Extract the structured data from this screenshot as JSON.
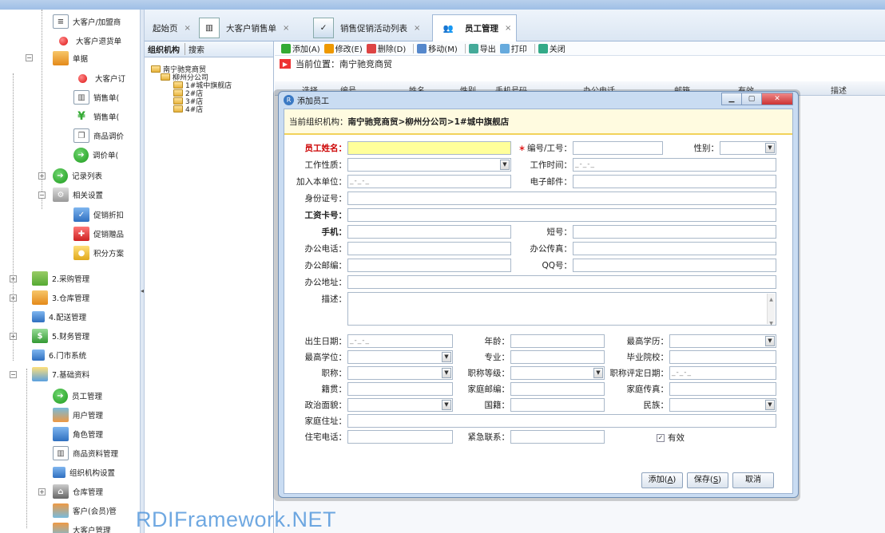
{
  "sidebar": {
    "items": [
      {
        "label": "大客户/加盟商"
      },
      {
        "label": "大客户退货单"
      },
      {
        "label": "单据"
      },
      {
        "label": "大客户订"
      },
      {
        "label": "销售单("
      },
      {
        "label": "销售单("
      },
      {
        "label": "商品调价"
      },
      {
        "label": "调价单("
      },
      {
        "label": "记录列表"
      },
      {
        "label": "相关设置"
      },
      {
        "label": "促销折扣"
      },
      {
        "label": "促销赠品"
      },
      {
        "label": "积分方案"
      },
      {
        "label": "2.采购管理"
      },
      {
        "label": "3.仓库管理"
      },
      {
        "label": "4.配送管理"
      },
      {
        "label": "5.财务管理"
      },
      {
        "label": "6.门市系统"
      },
      {
        "label": "7.基础资料"
      },
      {
        "label": "员工管理"
      },
      {
        "label": "用户管理"
      },
      {
        "label": "角色管理"
      },
      {
        "label": "商品资料管理"
      },
      {
        "label": "组织机构设置"
      },
      {
        "label": "仓库管理"
      },
      {
        "label": "客户(会员)管"
      },
      {
        "label": "大客户管理"
      }
    ]
  },
  "tabs": [
    {
      "label": "起始页",
      "close": "×"
    },
    {
      "label": "大客户销售单",
      "close": "×"
    },
    {
      "label": "销售促销活动列表",
      "close": "×"
    },
    {
      "label": "员工管理",
      "close": "×"
    }
  ],
  "org_panel": {
    "tab1": "组织机构",
    "tab2": "搜索",
    "nodes": [
      "南宁驰竞商贸",
      "柳州分公司",
      "1#城中旗舰店",
      "2#店",
      "3#店",
      "4#店"
    ]
  },
  "toolbar": {
    "add": "添加(A)",
    "edit": "修改(E)",
    "delete": "删除(D)",
    "move": "移动(M)",
    "export": "导出",
    "print": "打印",
    "close": "关闭"
  },
  "location": {
    "label": "当前位置：",
    "value": "南宁驰竞商贸"
  },
  "grid": {
    "columns": [
      "选择",
      "编号",
      "姓名",
      "性别",
      "手机号码",
      "办公电话",
      "邮箱",
      "有效",
      "描述"
    ]
  },
  "dialog": {
    "title": "添加员工",
    "org_path_label": "当前组织机构：",
    "org_path_value": "南宁驰竞商贸>柳州分公司>1#城中旗舰店",
    "fields": {
      "name": "员工姓名：",
      "code": "编号/工号：",
      "gender": "性别：",
      "work_type": "工作性质：",
      "work_time": "工作时间：",
      "join_date": "加入本单位：",
      "email": "电子邮件：",
      "id_card": "身份证号：",
      "salary_card": "工资卡号：",
      "mobile": "手机：",
      "short_no": "短号：",
      "office_phone": "办公电话：",
      "office_fax": "办公传真：",
      "office_zip": "办公邮编：",
      "qq": "QQ号：",
      "office_address": "办公地址：",
      "description": "描述：",
      "birthday": "出生日期：",
      "age": "年龄：",
      "highest_edu": "最高学历：",
      "highest_degree": "最高学位：",
      "major": "专业：",
      "school": "毕业院校：",
      "title": "职称：",
      "title_level": "职称等级：",
      "title_date": "职称评定日期：",
      "native_place": "籍贯：",
      "home_zip": "家庭邮编：",
      "home_fax": "家庭传真：",
      "political": "政治面貌：",
      "nationality": "国籍：",
      "ethnic": "民族：",
      "home_address": "家庭住址：",
      "home_phone": "住宅电话：",
      "emergency": "紧急联系："
    },
    "date_placeholder": "_-_-_",
    "valid_label": "有效",
    "valid_checked": true,
    "buttons": {
      "add": "添加(",
      "add_key": "A",
      "save": "保存(",
      "save_key": "S",
      "cancel": "取消"
    }
  },
  "watermark": "RDIFramework.NET",
  "colors": {
    "required_field": "#ffff9a",
    "dialog_frame": "#c9dcf2",
    "accent": "#3f8bd8"
  }
}
